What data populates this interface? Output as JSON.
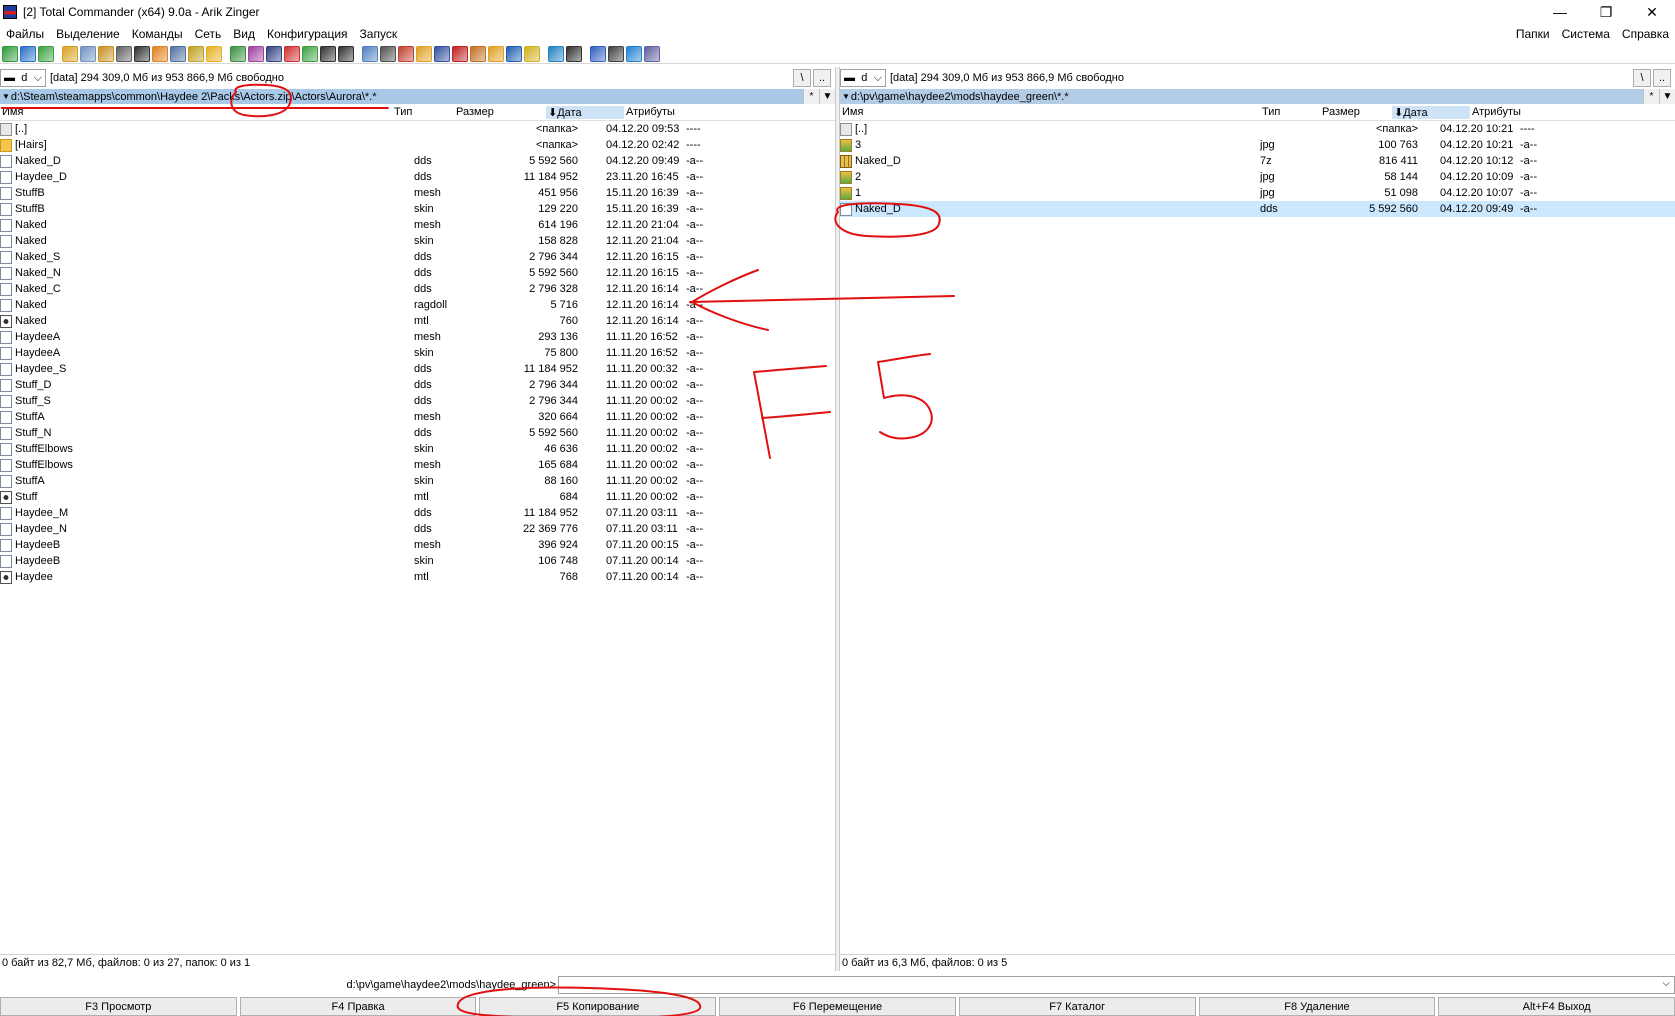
{
  "window": {
    "title": "[2] Total Commander (x64) 9.0a - Arik Zinger",
    "minimize": "—",
    "maximize": "❐",
    "close": "✕"
  },
  "menu": {
    "left": [
      "Файлы",
      "Выделение",
      "Команды",
      "Сеть",
      "Вид",
      "Конфигурация",
      "Запуск"
    ],
    "right": [
      "Папки",
      "Система",
      "Справка"
    ]
  },
  "toolbar": {
    "icon_colors": [
      "#2f9a3a",
      "#2a70c8",
      "#3aa040",
      "#d8a020",
      "#7090c0",
      "#c89020",
      "#606060",
      "#303030",
      "#e08020",
      "#5070a0",
      "#c0a020",
      "#e8b020",
      "#3a9040",
      "#a040a0",
      "#304080",
      "#d03030",
      "#40a040",
      "#303030",
      "#303030",
      "#5080c0",
      "#505050",
      "#c04030",
      "#e0a020",
      "#3050a0",
      "#c02020",
      "#c07020",
      "#e0a020",
      "#2060b0",
      "#d0b020",
      "#2080c0",
      "#303030",
      "#3060c0",
      "#404040",
      "#2080d0",
      "#6060a0"
    ]
  },
  "left_panel": {
    "drive": "d",
    "drive_info": "[data]  294 309,0 Мб из 953 866,9 Мб свободно",
    "root_btn": "\\",
    "up_btn": "..",
    "path": "d:\\Steam\\steamapps\\common\\Haydee 2\\Packs\\Actors.zip\\Actors\\Aurora\\*.*",
    "path_star": "*",
    "path_arrow": "▼",
    "columns": {
      "name": "Имя",
      "type": "Тип",
      "size": "Размер",
      "date": "⬇Дата",
      "attr": "Атрибуты"
    },
    "rows": [
      {
        "icon": "up",
        "name": "[..]",
        "type": "",
        "size": "<папка>",
        "date": "04.12.20 09:53",
        "attr": "----"
      },
      {
        "icon": "folder",
        "name": "[Hairs]",
        "type": "",
        "size": "<папка>",
        "date": "04.12.20 02:42",
        "attr": "----"
      },
      {
        "icon": "file",
        "name": "Naked_D",
        "type": "dds",
        "size": "5 592 560",
        "date": "04.12.20 09:49",
        "attr": "-a--"
      },
      {
        "icon": "file",
        "name": "Haydee_D",
        "type": "dds",
        "size": "11 184 952",
        "date": "23.11.20 16:45",
        "attr": "-a--"
      },
      {
        "icon": "file",
        "name": "StuffB",
        "type": "mesh",
        "size": "451 956",
        "date": "15.11.20 16:39",
        "attr": "-a--"
      },
      {
        "icon": "file",
        "name": "StuffB",
        "type": "skin",
        "size": "129 220",
        "date": "15.11.20 16:39",
        "attr": "-a--"
      },
      {
        "icon": "file",
        "name": "Naked",
        "type": "mesh",
        "size": "614 196",
        "date": "12.11.20 21:04",
        "attr": "-a--"
      },
      {
        "icon": "file",
        "name": "Naked",
        "type": "skin",
        "size": "158 828",
        "date": "12.11.20 21:04",
        "attr": "-a--"
      },
      {
        "icon": "file",
        "name": "Naked_S",
        "type": "dds",
        "size": "2 796 344",
        "date": "12.11.20 16:15",
        "attr": "-a--"
      },
      {
        "icon": "file",
        "name": "Naked_N",
        "type": "dds",
        "size": "5 592 560",
        "date": "12.11.20 16:15",
        "attr": "-a--"
      },
      {
        "icon": "file",
        "name": "Naked_C",
        "type": "dds",
        "size": "2 796 328",
        "date": "12.11.20 16:14",
        "attr": "-a--"
      },
      {
        "icon": "file",
        "name": "Naked",
        "type": "ragdoll",
        "size": "5 716",
        "date": "12.11.20 16:14",
        "attr": "-a--"
      },
      {
        "icon": "mtl",
        "name": "Naked",
        "type": "mtl",
        "size": "760",
        "date": "12.11.20 16:14",
        "attr": "-a--"
      },
      {
        "icon": "file",
        "name": "HaydeeA",
        "type": "mesh",
        "size": "293 136",
        "date": "11.11.20 16:52",
        "attr": "-a--"
      },
      {
        "icon": "file",
        "name": "HaydeeA",
        "type": "skin",
        "size": "75 800",
        "date": "11.11.20 16:52",
        "attr": "-a--"
      },
      {
        "icon": "file",
        "name": "Haydee_S",
        "type": "dds",
        "size": "11 184 952",
        "date": "11.11.20 00:32",
        "attr": "-a--"
      },
      {
        "icon": "file",
        "name": "Stuff_D",
        "type": "dds",
        "size": "2 796 344",
        "date": "11.11.20 00:02",
        "attr": "-a--"
      },
      {
        "icon": "file",
        "name": "Stuff_S",
        "type": "dds",
        "size": "2 796 344",
        "date": "11.11.20 00:02",
        "attr": "-a--"
      },
      {
        "icon": "file",
        "name": "StuffA",
        "type": "mesh",
        "size": "320 664",
        "date": "11.11.20 00:02",
        "attr": "-a--"
      },
      {
        "icon": "file",
        "name": "Stuff_N",
        "type": "dds",
        "size": "5 592 560",
        "date": "11.11.20 00:02",
        "attr": "-a--"
      },
      {
        "icon": "file",
        "name": "StuffElbows",
        "type": "skin",
        "size": "46 636",
        "date": "11.11.20 00:02",
        "attr": "-a--"
      },
      {
        "icon": "file",
        "name": "StuffElbows",
        "type": "mesh",
        "size": "165 684",
        "date": "11.11.20 00:02",
        "attr": "-a--"
      },
      {
        "icon": "file",
        "name": "StuffA",
        "type": "skin",
        "size": "88 160",
        "date": "11.11.20 00:02",
        "attr": "-a--"
      },
      {
        "icon": "mtl",
        "name": "Stuff",
        "type": "mtl",
        "size": "684",
        "date": "11.11.20 00:02",
        "attr": "-a--"
      },
      {
        "icon": "file",
        "name": "Haydee_M",
        "type": "dds",
        "size": "11 184 952",
        "date": "07.11.20 03:11",
        "attr": "-a--"
      },
      {
        "icon": "file",
        "name": "Haydee_N",
        "type": "dds",
        "size": "22 369 776",
        "date": "07.11.20 03:11",
        "attr": "-a--"
      },
      {
        "icon": "file",
        "name": "HaydeeB",
        "type": "mesh",
        "size": "396 924",
        "date": "07.11.20 00:15",
        "attr": "-a--"
      },
      {
        "icon": "file",
        "name": "HaydeeB",
        "type": "skin",
        "size": "106 748",
        "date": "07.11.20 00:14",
        "attr": "-a--"
      },
      {
        "icon": "mtl",
        "name": "Haydee",
        "type": "mtl",
        "size": "768",
        "date": "07.11.20 00:14",
        "attr": "-a--"
      }
    ],
    "status": "0 байт из 82,7 Мб, файлов: 0 из 27, папок: 0 из 1"
  },
  "right_panel": {
    "drive": "d",
    "drive_info": "[data]  294 309,0 Мб из 953 866,9 Мб свободно",
    "root_btn": "\\",
    "up_btn": "..",
    "path": "d:\\pv\\game\\haydee2\\mods\\haydee_green\\*.*",
    "path_star": "*",
    "path_arrow": "▼",
    "columns": {
      "name": "Имя",
      "type": "Тип",
      "size": "Размер",
      "date": "⬇Дата",
      "attr": "Атрибуты"
    },
    "rows": [
      {
        "icon": "up",
        "name": "[..]",
        "type": "",
        "size": "<папка>",
        "date": "04.12.20 10:21",
        "attr": "----",
        "selected": false
      },
      {
        "icon": "img",
        "name": "3",
        "type": "jpg",
        "size": "100 763",
        "date": "04.12.20 10:21",
        "attr": "-a--",
        "selected": false
      },
      {
        "icon": "zip",
        "name": "Naked_D",
        "type": "7z",
        "size": "816 411",
        "date": "04.12.20 10:12",
        "attr": "-a--",
        "selected": false
      },
      {
        "icon": "img",
        "name": "2",
        "type": "jpg",
        "size": "58 144",
        "date": "04.12.20 10:09",
        "attr": "-a--",
        "selected": false
      },
      {
        "icon": "img",
        "name": "1",
        "type": "jpg",
        "size": "51 098",
        "date": "04.12.20 10:07",
        "attr": "-a--",
        "selected": false
      },
      {
        "icon": "file",
        "name": "Naked_D",
        "type": "dds",
        "size": "5 592 560",
        "date": "04.12.20 09:49",
        "attr": "-a--",
        "selected": true
      }
    ],
    "status": "0 байт из 6,3 Мб, файлов: 0 из 5"
  },
  "command_line": {
    "prompt": "d:\\pv\\game\\haydee2\\mods\\haydee_green>",
    "value": "",
    "dropdown": "⌵"
  },
  "fkeys": [
    "F3 Просмотр",
    "F4 Правка",
    "F5 Копирование",
    "F6 Перемещение",
    "F7 Каталог",
    "F8 Удаление",
    "Alt+F4 Выход"
  ],
  "annotation": {
    "color": "#e01010",
    "handwritten_text": "F5"
  }
}
